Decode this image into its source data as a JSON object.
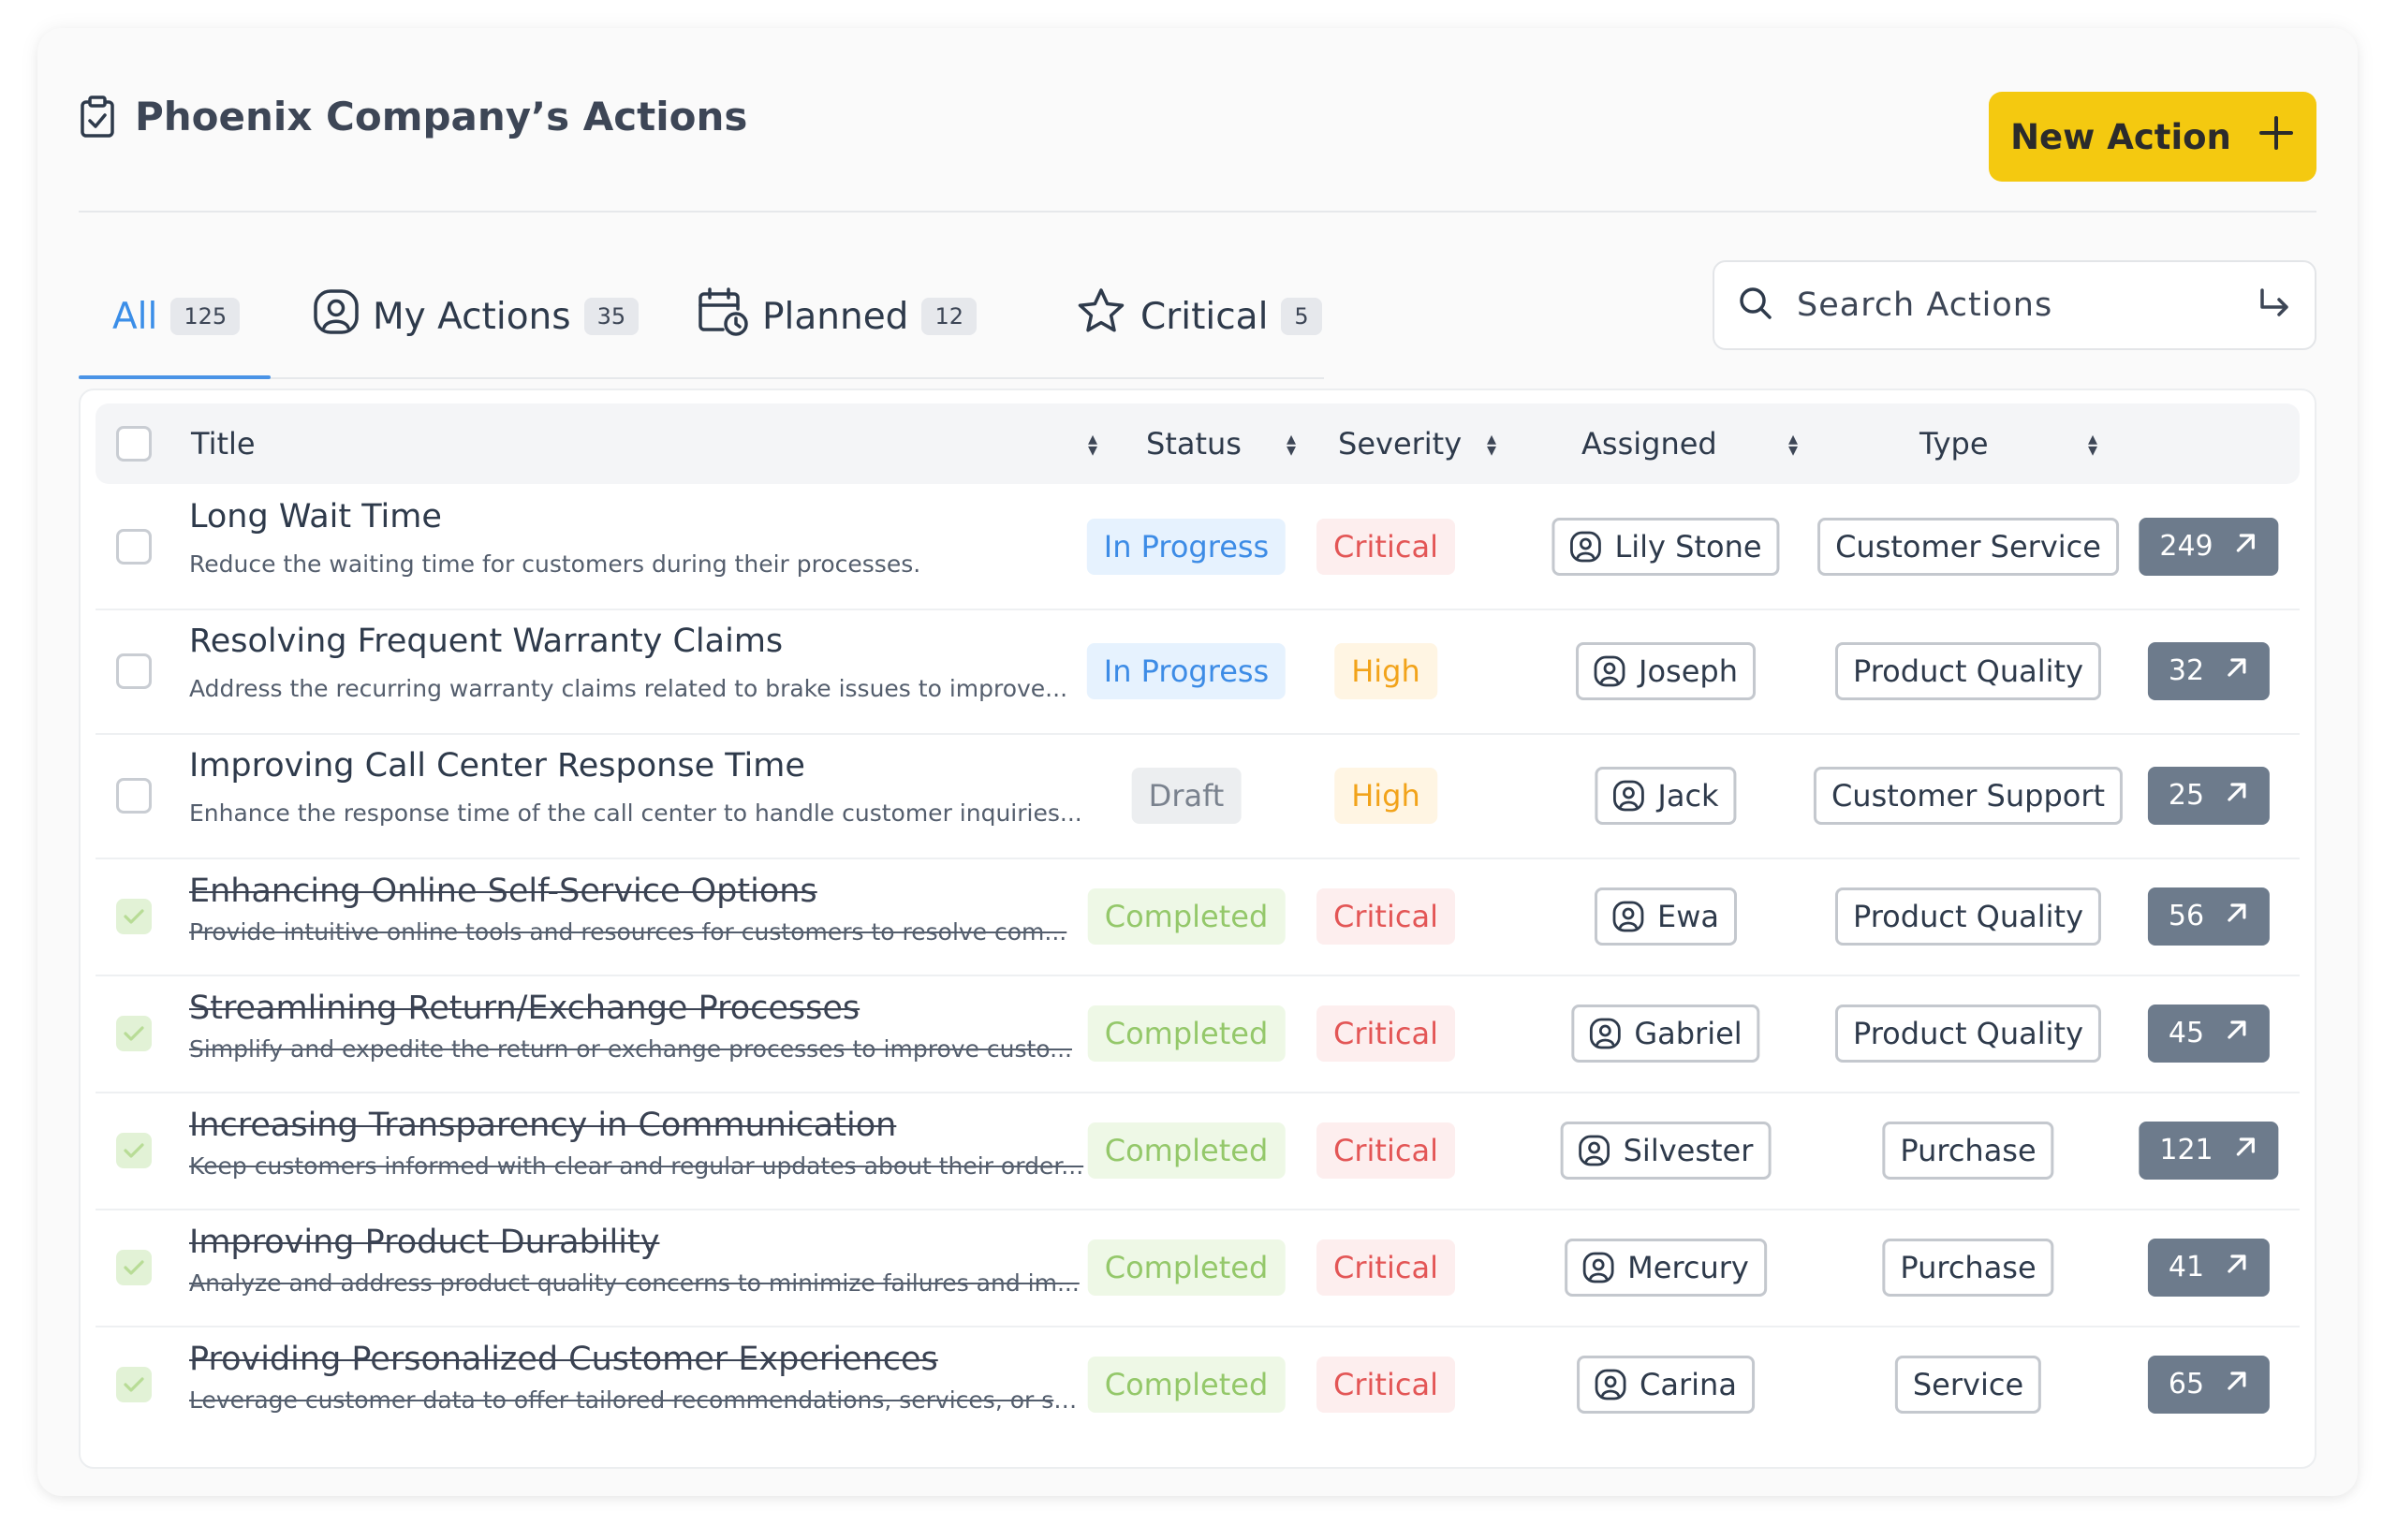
{
  "header": {
    "title": "Phoenix Company’s Actions",
    "new_action_label": "New Action"
  },
  "tabs": [
    {
      "label": "All",
      "count": "125",
      "active": true
    },
    {
      "label": "My Actions",
      "count": "35"
    },
    {
      "label": "Planned",
      "count": "12"
    },
    {
      "label": "Critical",
      "count": "5"
    }
  ],
  "search": {
    "placeholder": "Search Actions"
  },
  "table": {
    "columns": [
      "Title",
      "Status",
      "Severity",
      "Assigned",
      "Type"
    ],
    "rows": [
      {
        "title": "Long Wait Time",
        "desc": "Reduce the waiting time for customers during their processes.",
        "status": "In Progress",
        "severity": "Critical",
        "assigned": "Lily Stone",
        "type": "Customer Service",
        "count": "249",
        "checked": false
      },
      {
        "title": "Resolving Frequent Warranty Claims",
        "desc": "Address the recurring warranty claims related to brake issues to improve...",
        "status": "In Progress",
        "severity": "High",
        "assigned": "Joseph",
        "type": "Product Quality",
        "count": "32",
        "checked": false
      },
      {
        "title": "Improving Call Center Response Time",
        "desc": "Enhance the response time of the call center to handle customer inquiries...",
        "status": "Draft",
        "severity": "High",
        "assigned": "Jack",
        "type": "Customer Support",
        "count": "25",
        "checked": false
      },
      {
        "title": "Enhancing Online Self-Service Options",
        "desc": "Provide intuitive online tools and resources for customers to resolve com...",
        "status": "Completed",
        "severity": "Critical",
        "assigned": "Ewa",
        "type": "Product Quality",
        "count": "56",
        "checked": true
      },
      {
        "title": "Streamlining Return/Exchange Processes",
        "desc": "Simplify and expedite the return or exchange processes to improve custo...",
        "status": "Completed",
        "severity": "Critical",
        "assigned": "Gabriel",
        "type": "Product Quality",
        "count": "45",
        "checked": true
      },
      {
        "title": "Increasing Transparency in Communication",
        "desc": "Keep customers informed with clear and regular updates about their order...",
        "status": "Completed",
        "severity": "Critical",
        "assigned": "Silvester",
        "type": "Purchase",
        "count": "121",
        "checked": true
      },
      {
        "title": "Improving Product Durability",
        "desc": "Analyze and address product quality concerns to minimize failures and im...",
        "status": "Completed",
        "severity": "Critical",
        "assigned": "Mercury",
        "type": "Purchase",
        "count": "41",
        "checked": true
      },
      {
        "title": "Providing Personalized Customer Experiences",
        "desc": "Leverage customer data to offer tailored recommendations, services, or so...",
        "status": "Completed",
        "severity": "Critical",
        "assigned": "Carina",
        "type": "Service",
        "count": "65",
        "checked": true
      }
    ]
  },
  "colors": {
    "accent": "#f4c910",
    "active_tab": "#3b8ee8",
    "critical": "#e35656",
    "high": "#f2a31a",
    "completed": "#94c86a",
    "in_progress": "#3d8ce6",
    "link_button": "#6d7b8c"
  }
}
